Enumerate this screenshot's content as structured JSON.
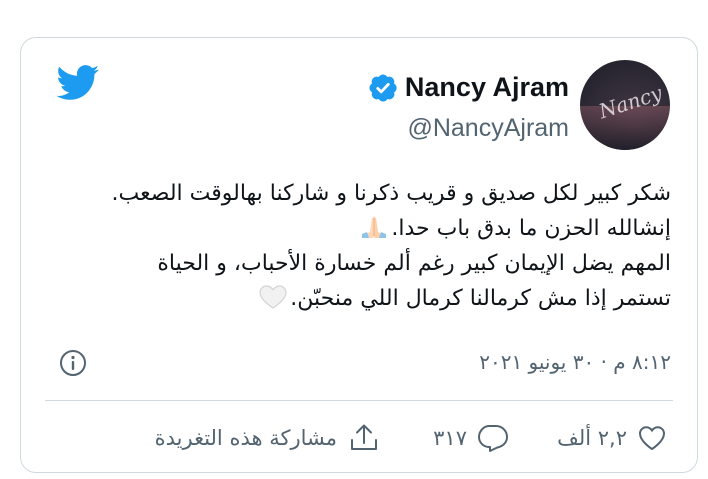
{
  "author": {
    "name": "Nancy Ajram",
    "handle": "@NancyAjram",
    "verified": true
  },
  "tweet": {
    "lines": [
      "شكر كبير لكل صديق و قريب ذكرنا و شاركنا بهالوقت الصعب.",
      "إنشالله الحزن ما بدق باب حدا.",
      "المهم يضل الإيمان كبير رغم ألم خسارة الأحباب، و الحياة",
      "تستمر إذا مش كرمالنا كرمال اللي منحبّن."
    ],
    "emojis": [
      "folded-hands",
      "white-heart"
    ]
  },
  "timestamp": "٨:١٢ م · ٣٠ يونيو ٢٠٢١",
  "actions": {
    "likes": "٢,٢ ألف",
    "replies": "٣١٧",
    "share_label": "مشاركة هذه التغريدة"
  },
  "colors": {
    "brand": "#1d9bf0",
    "muted": "#536471",
    "border": "#cfd9de",
    "text": "#0f1419"
  },
  "icons": [
    "twitter-bird-icon",
    "verified-badge-icon",
    "info-icon",
    "heart-icon",
    "reply-icon",
    "share-icon"
  ]
}
